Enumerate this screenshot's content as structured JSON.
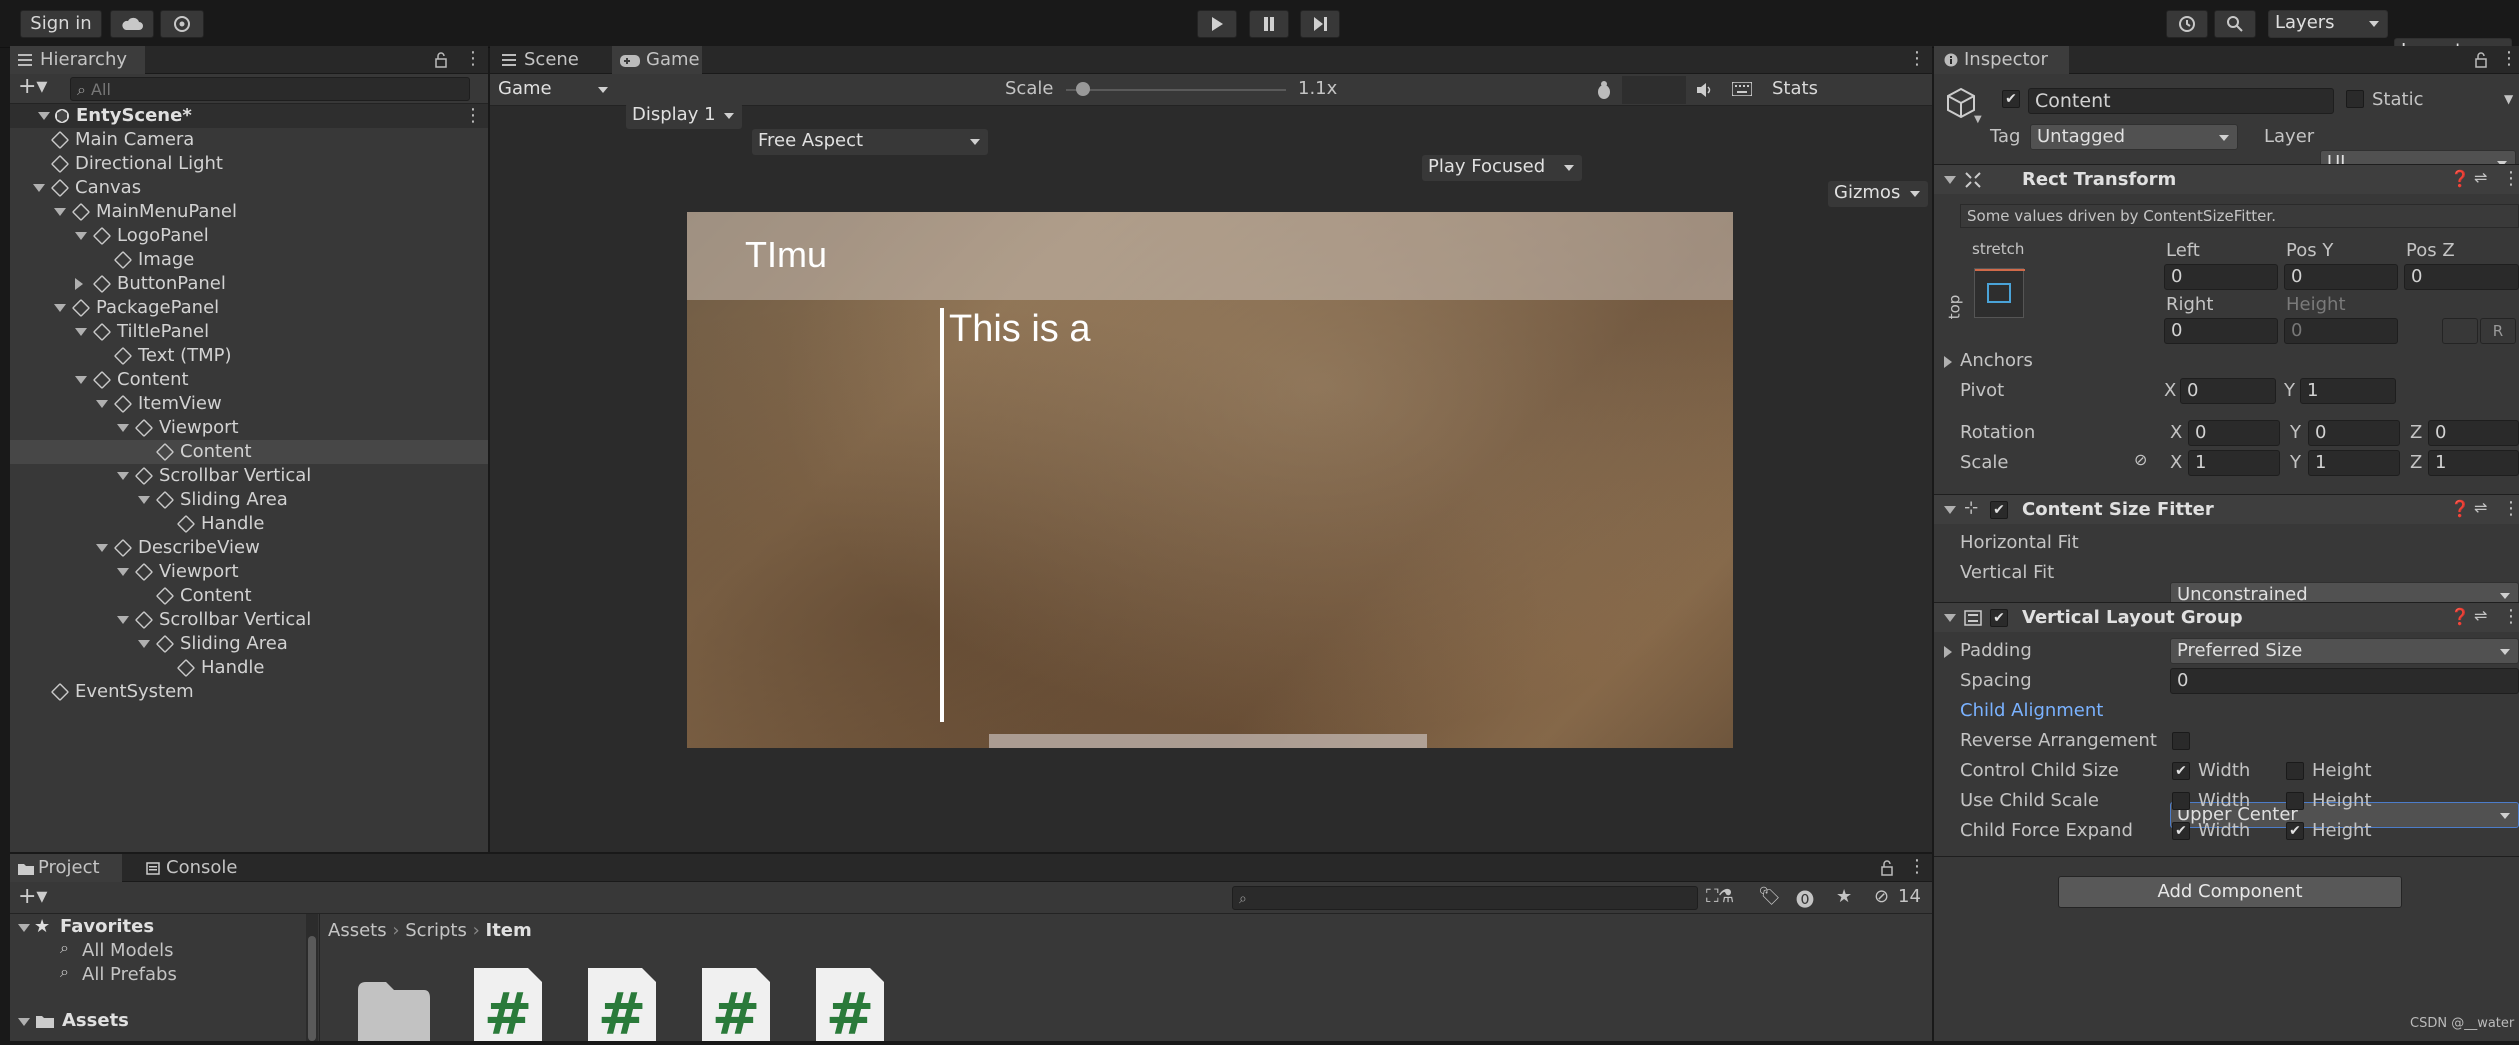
{
  "toolbar": {
    "sign_in": "Sign in",
    "layers": "Layers",
    "layout": "Layout"
  },
  "hierarchy": {
    "tab": "Hierarchy",
    "search_placeholder": "All",
    "scene": "EntyScene*",
    "items": [
      "Main Camera",
      "Directional Light",
      "Canvas",
      "MainMenuPanel",
      "LogoPanel",
      "Image",
      "ButtonPanel",
      "PackagePanel",
      "TiltlePanel",
      "Text (TMP)",
      "Content",
      "ItemView",
      "Viewport",
      "Content",
      "Scrollbar Vertical",
      "Sliding Area",
      "Handle",
      "DescribeView",
      "Viewport",
      "Content",
      "Scrollbar Vertical",
      "Sliding Area",
      "Handle",
      "EventSystem"
    ]
  },
  "view": {
    "tab_scene": "Scene",
    "tab_game": "Game",
    "game": "Game",
    "display": "Display 1",
    "aspect": "Free Aspect",
    "scale_label": "Scale",
    "scale_value": "1.1x",
    "play_focused": "Play Focused",
    "stats": "Stats",
    "gizmos": "Gizmos",
    "game_title": "TImu",
    "game_text": "This is a"
  },
  "inspector": {
    "tab": "Inspector",
    "object_name": "Content",
    "static": "Static",
    "tag_label": "Tag",
    "tag": "Untagged",
    "layer_label": "Layer",
    "layer": "UI",
    "rect": {
      "title": "Rect Transform",
      "note": "Some values driven by ContentSizeFitter.",
      "stretch": "stretch",
      "top": "top",
      "left_label": "Left",
      "posy_label": "Pos Y",
      "posz_label": "Pos Z",
      "left": "0",
      "posy": "0",
      "posz": "0",
      "right_label": "Right",
      "height_label": "Height",
      "right": "0",
      "height": "0",
      "anchors": "Anchors",
      "pivot": "Pivot",
      "pivot_x": "0",
      "pivot_y": "1",
      "rotation": "Rotation",
      "rot_x": "0",
      "rot_y": "0",
      "rot_z": "0",
      "scale": "Scale",
      "scale_x": "1",
      "scale_y": "1",
      "scale_z": "1",
      "x": "X",
      "y": "Y",
      "z": "Z"
    },
    "csf": {
      "title": "Content Size Fitter",
      "h_label": "Horizontal Fit",
      "h": "Unconstrained",
      "v_label": "Vertical Fit",
      "v": "Preferred Size"
    },
    "vlg": {
      "title": "Vertical Layout Group",
      "padding": "Padding",
      "spacing_label": "Spacing",
      "spacing": "0",
      "align_label": "Child Alignment",
      "align": "Upper Center",
      "reverse": "Reverse Arrangement",
      "control": "Control Child Size",
      "use_scale": "Use Child Scale",
      "force": "Child Force Expand",
      "width": "Width",
      "height": "Height"
    },
    "add_component": "Add Component"
  },
  "project": {
    "tab_project": "Project",
    "tab_console": "Console",
    "favorites": "Favorites",
    "all_models": "All Models",
    "all_prefabs": "All Prefabs",
    "assets": "Assets",
    "breadcrumb": [
      "Assets",
      "Scripts",
      "Item"
    ],
    "hidden_count": "14"
  },
  "watermark": "CSDN @__water",
  "colors": {
    "accent_blue": "#4c7cc9",
    "label_blue": "#7ab2ff",
    "bg": "#383838"
  }
}
